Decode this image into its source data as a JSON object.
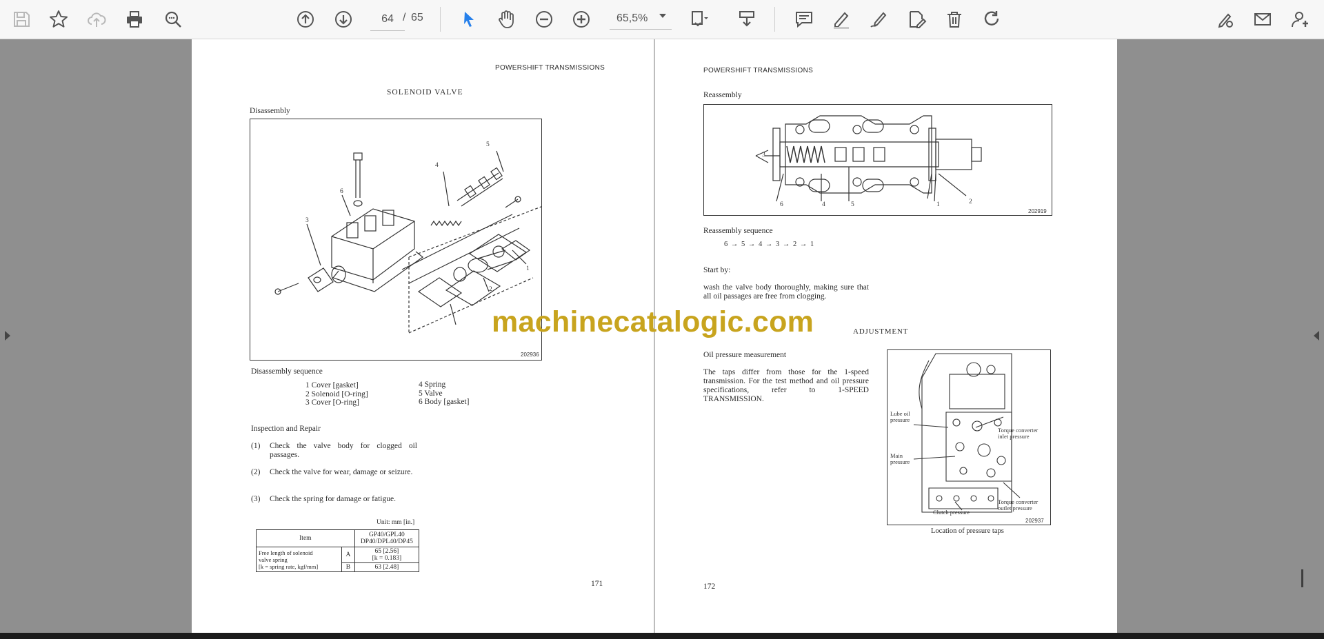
{
  "toolbar": {
    "current_page": "64",
    "page_separator": "/",
    "total_pages": "65",
    "zoom": "65,5%"
  },
  "left_page": {
    "header": "POWERSHIFT TRANSMISSIONS",
    "title": "SOLENOID VALVE",
    "section": "Disassembly",
    "figure_number": "202936",
    "figure_labels": [
      "1",
      "2",
      "3",
      "4",
      "5",
      "6"
    ],
    "sequence_heading": "Disassembly sequence",
    "sequence_col1": [
      "1 Cover [gasket]",
      "2 Solenoid [O-ring]",
      "3 Cover [O-ring]"
    ],
    "sequence_col2": [
      "4 Spring",
      "5 Valve",
      "6 Body [gasket]"
    ],
    "inspection_heading": "Inspection and Repair",
    "inspection_items": [
      {
        "num": "(1)",
        "text": "Check the valve body for clogged oil passages."
      },
      {
        "num": "(2)",
        "text": "Check the valve for wear, damage or seizure."
      },
      {
        "num": "(3)",
        "text": "Check the spring for damage or fatigue."
      }
    ],
    "unit_note": "Unit: mm [in.]",
    "table": {
      "item_header": "Item",
      "model_header_1": "GP40/GPL40",
      "model_header_2": "DP40/DPL40/DP45",
      "row_label_1": "Free length of solenoid",
      "row_label_2": "valve spring",
      "row_label_3": "[k = spring rate, kgf/mm]",
      "row_a_tag": "A",
      "row_a_value_1": "65 [2.56]",
      "row_a_value_2": "[k = 0.183]",
      "row_b_tag": "B",
      "row_b_value": "63 [2.48]"
    },
    "page_number": "171"
  },
  "right_page": {
    "header": "POWERSHIFT TRANSMISSIONS",
    "section": "Reassembly",
    "figure_number": "202919",
    "figure_labels": [
      "3",
      "6",
      "4",
      "5",
      "1",
      "2"
    ],
    "sequence_heading": "Reassembly sequence",
    "sequence": [
      "6",
      "5",
      "4",
      "3",
      "2",
      "1"
    ],
    "sequence_arrow": "→",
    "start_heading": "Start by:",
    "start_text": "wash the valve body thoroughly, making sure that all oil passages are free from clogging.",
    "adjustment_heading": "ADJUSTMENT",
    "oil_heading": "Oil pressure measurement",
    "oil_text": "The taps differ from those for the 1-speed transmission. For the test method and oil pressure specifications, refer to 1-SPEED TRANSMISSION.",
    "tap_figure_number": "202937",
    "tap_labels": {
      "lube_1": "Lube oil",
      "lube_2": "pressure",
      "torque_inlet_1": "Torque converter",
      "torque_inlet_2": "inlet pressure",
      "main_1": "Main",
      "main_2": "pressure",
      "torque_outlet_1": "Torque converter",
      "torque_outlet_2": "outlet pressure",
      "clutch": "Clutch pressure"
    },
    "tap_caption": "Location of pressure taps",
    "page_number": "172"
  },
  "watermark": "machinecatalogic.com",
  "icons": [
    "save-icon",
    "bookmark-star-icon",
    "cloud-upload-icon",
    "print-icon",
    "zoom-search-icon",
    "page-up-icon",
    "page-down-icon",
    "select-cursor-icon",
    "hand-pan-icon",
    "zoom-out-icon",
    "zoom-in-icon",
    "page-fit-icon",
    "stamp-icon",
    "comment-icon",
    "highlight-pen-icon",
    "sign-icon",
    "edit-pdf-icon",
    "delete-icon",
    "rotate-icon",
    "sign-request-icon",
    "email-icon",
    "add-user-icon"
  ],
  "colors": {
    "accent_blue": "#2680eb",
    "watermark": "#c8a41e"
  }
}
